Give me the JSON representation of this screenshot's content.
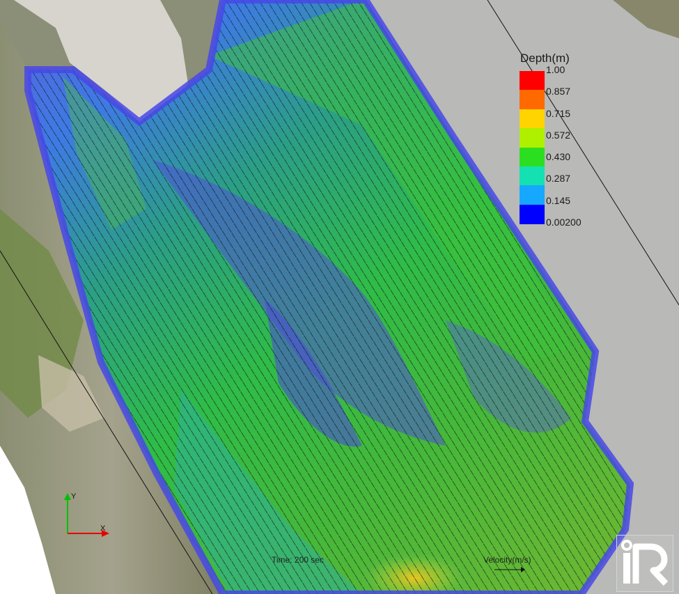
{
  "window": {
    "title": ""
  },
  "legend": {
    "title": "Depth(m)",
    "labels": [
      "1.00",
      "0.857",
      "0.715",
      "0.572",
      "0.430",
      "0.287",
      "0.145",
      "0.00200"
    ],
    "colors": [
      "#ff0000",
      "#ff6a00",
      "#ffd400",
      "#aef000",
      "#2cde20",
      "#15e0b2",
      "#16a8ff",
      "#0000ff"
    ]
  },
  "overlay": {
    "time_label": "Time: 200 sec",
    "velocity_label": "Velocity(m/s)"
  },
  "axes": {
    "x_label": "X",
    "y_label": "Y",
    "x_color": "#e60000",
    "y_color": "#00c000"
  },
  "logo": {
    "text": "iRIC"
  }
}
